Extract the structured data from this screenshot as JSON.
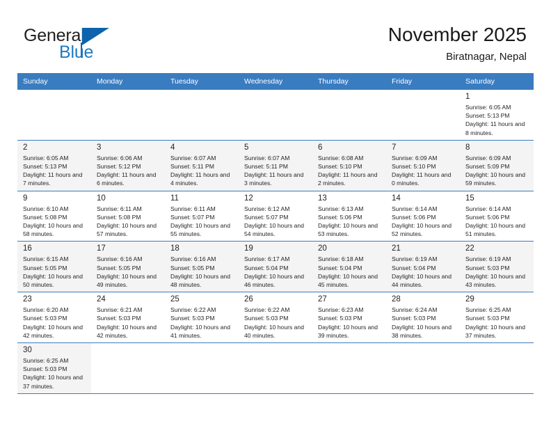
{
  "brand": {
    "name_top": "General",
    "name_bottom": "Blue",
    "accent_color": "#0d63ad",
    "text_color": "#231f20"
  },
  "header": {
    "title": "November 2025",
    "subtitle": "Biratnagar, Nepal"
  },
  "theme": {
    "header_row_bg": "#3a7cc0",
    "header_row_text": "#ffffff",
    "shaded_row_bg": "#f4f4f4",
    "grid_line": "#3a7cc0"
  },
  "calendar": {
    "weekday_headers": [
      "Sunday",
      "Monday",
      "Tuesday",
      "Wednesday",
      "Thursday",
      "Friday",
      "Saturday"
    ],
    "weeks": [
      [
        {
          "day": "",
          "info": ""
        },
        {
          "day": "",
          "info": ""
        },
        {
          "day": "",
          "info": ""
        },
        {
          "day": "",
          "info": ""
        },
        {
          "day": "",
          "info": ""
        },
        {
          "day": "",
          "info": ""
        },
        {
          "day": "1",
          "info": "Sunrise: 6:05 AM Sunset: 5:13 PM Daylight: 11 hours and 8 minutes."
        }
      ],
      [
        {
          "day": "2",
          "info": "Sunrise: 6:05 AM Sunset: 5:13 PM Daylight: 11 hours and 7 minutes."
        },
        {
          "day": "3",
          "info": "Sunrise: 6:06 AM Sunset: 5:12 PM Daylight: 11 hours and 6 minutes."
        },
        {
          "day": "4",
          "info": "Sunrise: 6:07 AM Sunset: 5:11 PM Daylight: 11 hours and 4 minutes."
        },
        {
          "day": "5",
          "info": "Sunrise: 6:07 AM Sunset: 5:11 PM Daylight: 11 hours and 3 minutes."
        },
        {
          "day": "6",
          "info": "Sunrise: 6:08 AM Sunset: 5:10 PM Daylight: 11 hours and 2 minutes."
        },
        {
          "day": "7",
          "info": "Sunrise: 6:09 AM Sunset: 5:10 PM Daylight: 11 hours and 0 minutes."
        },
        {
          "day": "8",
          "info": "Sunrise: 6:09 AM Sunset: 5:09 PM Daylight: 10 hours and 59 minutes."
        }
      ],
      [
        {
          "day": "9",
          "info": "Sunrise: 6:10 AM Sunset: 5:08 PM Daylight: 10 hours and 58 minutes."
        },
        {
          "day": "10",
          "info": "Sunrise: 6:11 AM Sunset: 5:08 PM Daylight: 10 hours and 57 minutes."
        },
        {
          "day": "11",
          "info": "Sunrise: 6:11 AM Sunset: 5:07 PM Daylight: 10 hours and 55 minutes."
        },
        {
          "day": "12",
          "info": "Sunrise: 6:12 AM Sunset: 5:07 PM Daylight: 10 hours and 54 minutes."
        },
        {
          "day": "13",
          "info": "Sunrise: 6:13 AM Sunset: 5:06 PM Daylight: 10 hours and 53 minutes."
        },
        {
          "day": "14",
          "info": "Sunrise: 6:14 AM Sunset: 5:06 PM Daylight: 10 hours and 52 minutes."
        },
        {
          "day": "15",
          "info": "Sunrise: 6:14 AM Sunset: 5:06 PM Daylight: 10 hours and 51 minutes."
        }
      ],
      [
        {
          "day": "16",
          "info": "Sunrise: 6:15 AM Sunset: 5:05 PM Daylight: 10 hours and 50 minutes."
        },
        {
          "day": "17",
          "info": "Sunrise: 6:16 AM Sunset: 5:05 PM Daylight: 10 hours and 49 minutes."
        },
        {
          "day": "18",
          "info": "Sunrise: 6:16 AM Sunset: 5:05 PM Daylight: 10 hours and 48 minutes."
        },
        {
          "day": "19",
          "info": "Sunrise: 6:17 AM Sunset: 5:04 PM Daylight: 10 hours and 46 minutes."
        },
        {
          "day": "20",
          "info": "Sunrise: 6:18 AM Sunset: 5:04 PM Daylight: 10 hours and 45 minutes."
        },
        {
          "day": "21",
          "info": "Sunrise: 6:19 AM Sunset: 5:04 PM Daylight: 10 hours and 44 minutes."
        },
        {
          "day": "22",
          "info": "Sunrise: 6:19 AM Sunset: 5:03 PM Daylight: 10 hours and 43 minutes."
        }
      ],
      [
        {
          "day": "23",
          "info": "Sunrise: 6:20 AM Sunset: 5:03 PM Daylight: 10 hours and 42 minutes."
        },
        {
          "day": "24",
          "info": "Sunrise: 6:21 AM Sunset: 5:03 PM Daylight: 10 hours and 42 minutes."
        },
        {
          "day": "25",
          "info": "Sunrise: 6:22 AM Sunset: 5:03 PM Daylight: 10 hours and 41 minutes."
        },
        {
          "day": "26",
          "info": "Sunrise: 6:22 AM Sunset: 5:03 PM Daylight: 10 hours and 40 minutes."
        },
        {
          "day": "27",
          "info": "Sunrise: 6:23 AM Sunset: 5:03 PM Daylight: 10 hours and 39 minutes."
        },
        {
          "day": "28",
          "info": "Sunrise: 6:24 AM Sunset: 5:03 PM Daylight: 10 hours and 38 minutes."
        },
        {
          "day": "29",
          "info": "Sunrise: 6:25 AM Sunset: 5:03 PM Daylight: 10 hours and 37 minutes."
        }
      ],
      [
        {
          "day": "30",
          "info": "Sunrise: 6:25 AM Sunset: 5:03 PM Daylight: 10 hours and 37 minutes."
        },
        {
          "day": "",
          "info": ""
        },
        {
          "day": "",
          "info": ""
        },
        {
          "day": "",
          "info": ""
        },
        {
          "day": "",
          "info": ""
        },
        {
          "day": "",
          "info": ""
        },
        {
          "day": "",
          "info": ""
        }
      ]
    ]
  }
}
